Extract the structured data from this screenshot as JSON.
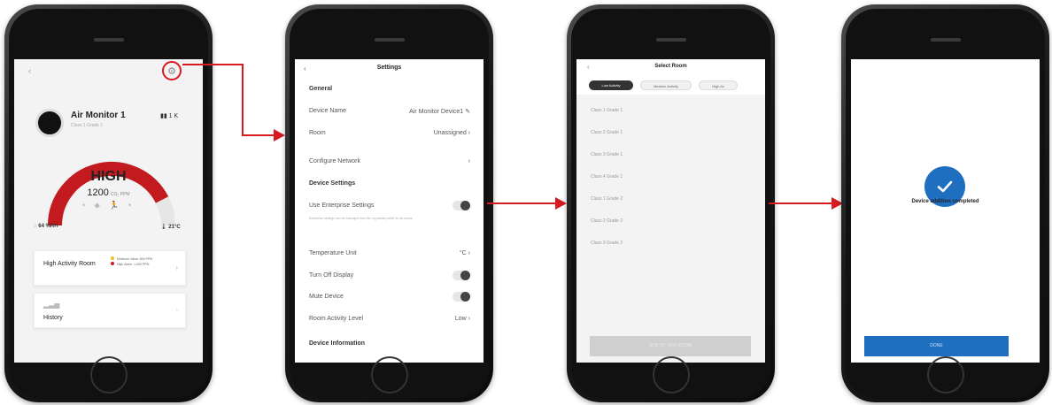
{
  "colors": {
    "accent_red": "#d71920",
    "brand_blue": "#1e6fc0",
    "gauge_track": "#e6e6e6"
  },
  "screen1": {
    "back_glyph": "‹",
    "settings_icon": "gear-icon",
    "device_title": "Air Monitor 1",
    "device_subtitle": "Class 1 Grade 1",
    "battery": "▮▮ 1 K",
    "level": "HIGH",
    "ppm_value": "1200",
    "ppm_unit": "CO₂ PPM",
    "gauge_fraction": 0.85,
    "humidity": "64 %RH",
    "temperature": "21°C",
    "activity_label": "High Activity Room",
    "legend": [
      "Minimum Value: 800 PPM",
      "High Alarm: 1,000 PPM"
    ],
    "history_label": "History"
  },
  "screen2": {
    "back": "‹",
    "title": "Settings",
    "general_header": "General",
    "device_name_label": "Device Name",
    "device_name_value": "Air Monitor Device1 ✎",
    "room_label": "Room",
    "room_value": "Unassigned ›",
    "configure_network_label": "Configure Network",
    "configure_network_chev": "›",
    "device_settings_header": "Device Settings",
    "enterprise_label": "Use Enterprise Settings",
    "enterprise_hint": "Enterprise settings can be managed from the org admin portal for all rooms.",
    "temperature_unit_label": "Temperature Unit",
    "temperature_unit_value": "°C ›",
    "turn_off_display_label": "Turn Off Display",
    "mute_device_label": "Mute Device",
    "room_activity_label": "Room Activity Level",
    "room_activity_value": "Low ›",
    "device_information_header": "Device Information"
  },
  "screen3": {
    "back": "‹",
    "title": "Select Room",
    "chips": [
      "Low Activity",
      "Medium Activity",
      "High Ac"
    ],
    "rooms": [
      "Class 1 Grade 1",
      "Class 2 Grade 1",
      "Class 3 Grade 1",
      "Class 4 Grade 1",
      "Class 1 Grade 2",
      "Class 2 Grade 2",
      "Class 3 Grade 2"
    ],
    "add_button": "ADD TO THIS ROOM"
  },
  "screen4": {
    "message": "Device addition completed",
    "done_button": "DONE"
  }
}
